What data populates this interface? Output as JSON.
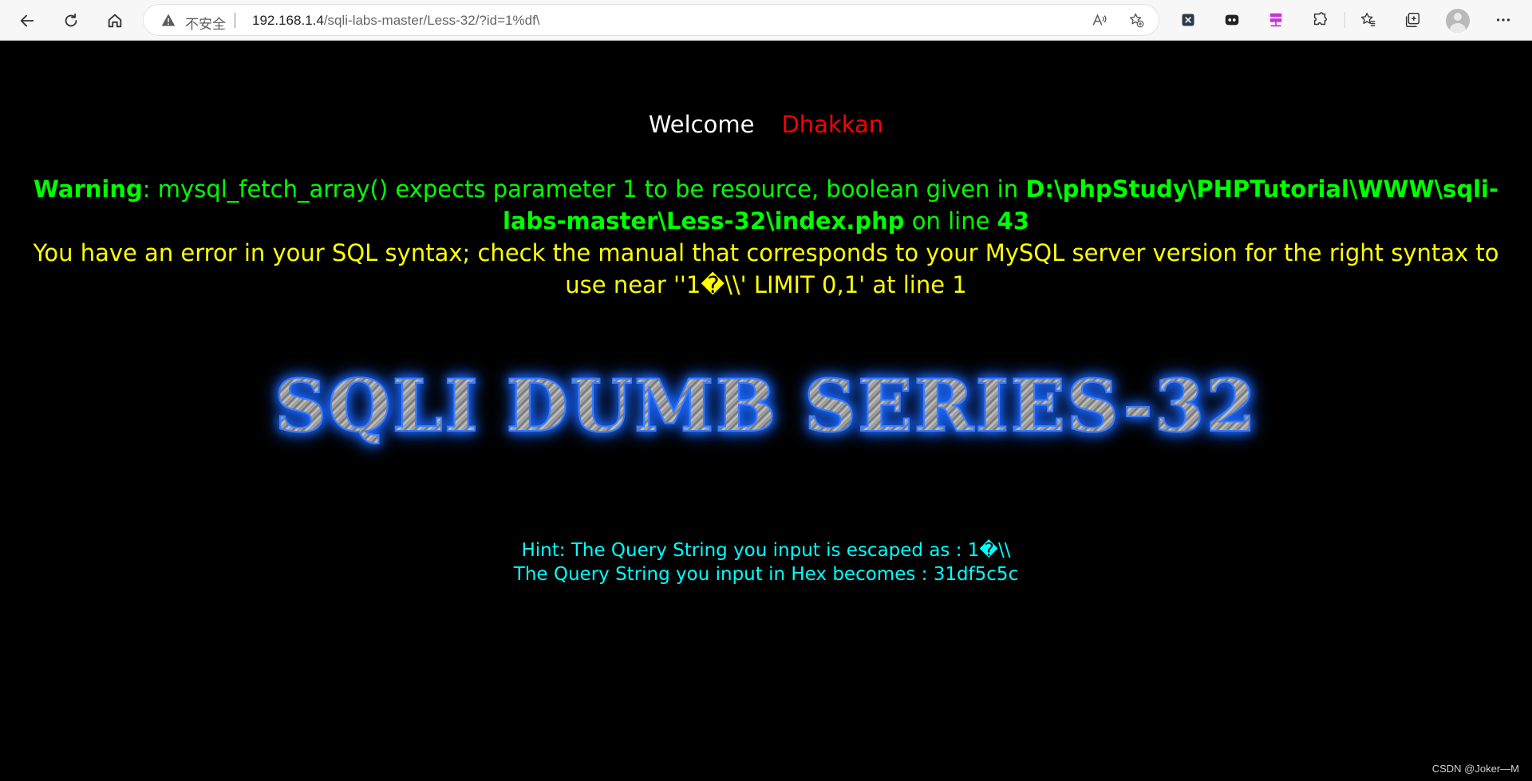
{
  "browser": {
    "security_label": "不安全",
    "url_host": "192.168.1.4",
    "url_path": "/sqli-labs-master/Less-32/?id=1%df\\"
  },
  "page": {
    "welcome": "Welcome",
    "user": "Dhakkan",
    "warning_label": "Warning",
    "warning_msg": ": mysql_fetch_array() expects parameter 1 to be resource, boolean given in ",
    "warning_path": "D:\\phpStudy\\PHPTutorial\\WWW\\sqli-labs-master\\Less-32\\index.php",
    "warning_on_line": " on line ",
    "warning_line": "43",
    "sql_error": "You have an error in your SQL syntax; check the manual that corresponds to your MySQL server version for the right syntax to use near ''1�\\\\' LIMIT 0,1' at line 1",
    "banner": "SQLI DUMB SERIES-32",
    "hint_line1": "Hint: The Query String you input is escaped as : 1�\\\\",
    "hint_line2": "The Query String you input in Hex becomes : 31df5c5c"
  },
  "watermark": "CSDN @Joker—M",
  "icons": {
    "back": "back-arrow-icon",
    "refresh": "refresh-icon",
    "home": "home-icon",
    "warning": "warning-icon",
    "read_aloud": "read-aloud-icon",
    "add_favorite": "add-favorite-icon",
    "ext_x": "extension-x-icon",
    "ext_game": "extension-game-icon",
    "ext_server": "extension-server-icon",
    "extensions": "puzzle-icon",
    "favorites": "favorites-icon",
    "collections": "collections-icon",
    "profile": "avatar",
    "more": "more-icon"
  },
  "colors": {
    "welcome": "#ffffff",
    "user": "#ff0000",
    "warning": "#00ff00",
    "sql_error": "#ffff00",
    "hint": "#00ffff",
    "banner_glow": "#1e6dff"
  }
}
